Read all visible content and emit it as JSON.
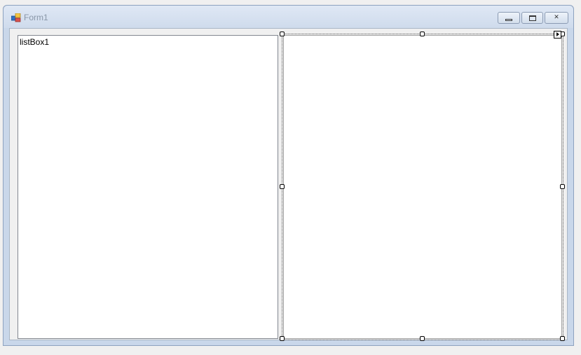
{
  "window": {
    "title": "Form1",
    "icon": "form-icon"
  },
  "caption_buttons": {
    "minimize_icon": "minimize-icon",
    "maximize_icon": "maximize-icon",
    "close_icon": "close-icon",
    "close_glyph": "✕"
  },
  "designer": {
    "listbox_label": "listBox1",
    "smart_tag_icon": "smart-tag-arrow-icon"
  }
}
